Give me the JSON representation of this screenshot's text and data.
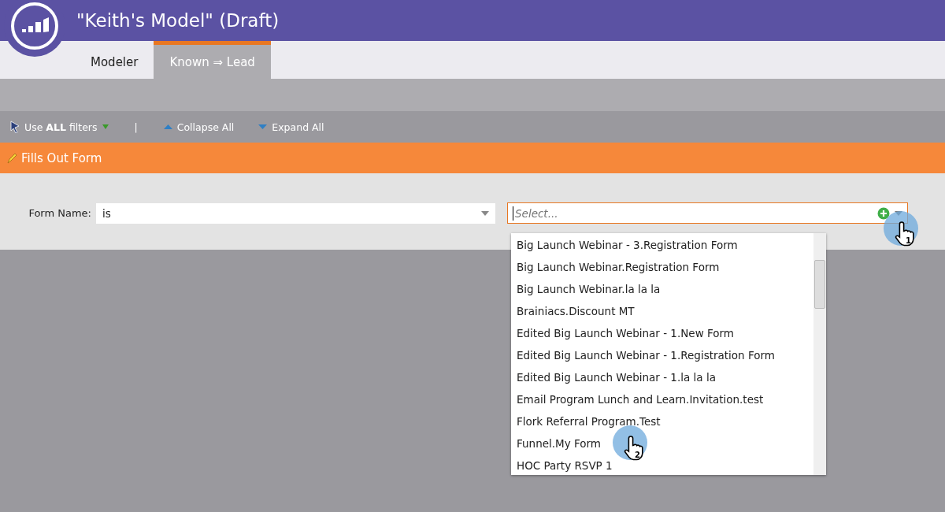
{
  "window": {
    "title": "\"Keith's Model\" (Draft)"
  },
  "tabs": [
    {
      "label": "Modeler",
      "selected": false
    },
    {
      "label": "Known ⇒ Lead",
      "selected": true
    }
  ],
  "toolbar": {
    "filter_mode": "Use **ALL** filters",
    "separator": "|",
    "collapse": "Collapse All",
    "expand": "Expand All"
  },
  "trigger": {
    "title": "Fills Out Form"
  },
  "condition": {
    "label": "Form Name:",
    "operator": "is",
    "value_placeholder": "Select...",
    "options": [
      {
        "label": "Big Launch Webinar - 3.Registration Form",
        "selected": false
      },
      {
        "label": "Big Launch Webinar.Registration Form",
        "selected": false
      },
      {
        "label": "Big Launch Webinar.la la la",
        "selected": false
      },
      {
        "label": "Brainiacs.Discount MT",
        "selected": false
      },
      {
        "label": "Edited Big Launch Webinar - 1.New Form",
        "selected": false
      },
      {
        "label": "Edited Big Launch Webinar - 1.Registration Form",
        "selected": false
      },
      {
        "label": "Edited Big Launch Webinar - 1.la la la",
        "selected": false
      },
      {
        "label": "Email Program Lunch and Learn.Invitation.test",
        "selected": false
      },
      {
        "label": "Flork Referral Program.Test",
        "selected": false
      },
      {
        "label": "Funnel.My Form",
        "selected": false
      },
      {
        "label": "HOC Party RSVP 1",
        "selected": false
      }
    ]
  },
  "click_markers": [
    {
      "step": "1"
    },
    {
      "step": "2"
    }
  ]
}
